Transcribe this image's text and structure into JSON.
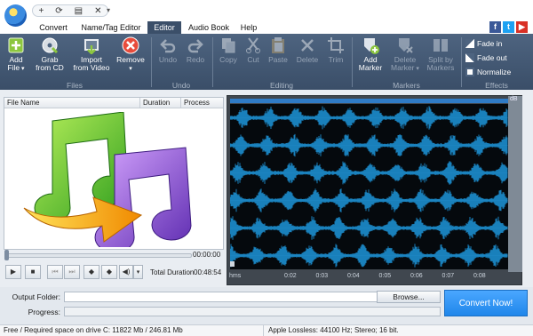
{
  "tabs": [
    "Convert",
    "Name/Tag Editor",
    "Editor",
    "Audio Book",
    "Help"
  ],
  "ribbon": {
    "files": {
      "group": "Files",
      "add": "Add\nFile",
      "grab": "Grab\nfrom CD",
      "import": "Import\nfrom Video",
      "remove": "Remove"
    },
    "undo": {
      "group": "Undo",
      "undo": "Undo",
      "redo": "Redo"
    },
    "editing": {
      "group": "Editing",
      "copy": "Copy",
      "cut": "Cut",
      "paste": "Paste",
      "delete": "Delete",
      "trim": "Trim"
    },
    "markers": {
      "group": "Markers",
      "add": "Add\nMarker",
      "delete": "Delete\nMarker",
      "split": "Split by\nMarkers"
    },
    "effects": {
      "group": "Effects",
      "fade_in": "Fade in",
      "fade_out": "Fade out",
      "normalize": "Normalize"
    }
  },
  "file_list": {
    "columns": [
      "File Name",
      "Duration",
      "Process"
    ]
  },
  "player": {
    "time": "00:00:00",
    "total_label": "Total Duration",
    "total": "00:48:54"
  },
  "waveform": {
    "db_label": "dB",
    "hms_label": "hms",
    "ticks": [
      "0:02",
      "0:03",
      "0:04",
      "0:05",
      "0:06",
      "0:07",
      "0:08"
    ],
    "channels": 6
  },
  "bottom": {
    "output_label": "Output Folder:",
    "browse": "Browse...",
    "progress_label": "Progress:",
    "convert": "Convert Now!"
  },
  "status": {
    "space": "Free / Required space on drive  C: 11822 Mb / 246.81 Mb",
    "format": "Apple Lossless:  44100  Hz; Stereo; 16 bit."
  },
  "colors": {
    "accent": "#1f86ea",
    "ribbon": "#44586f",
    "waveform": "#1f9fe8"
  }
}
